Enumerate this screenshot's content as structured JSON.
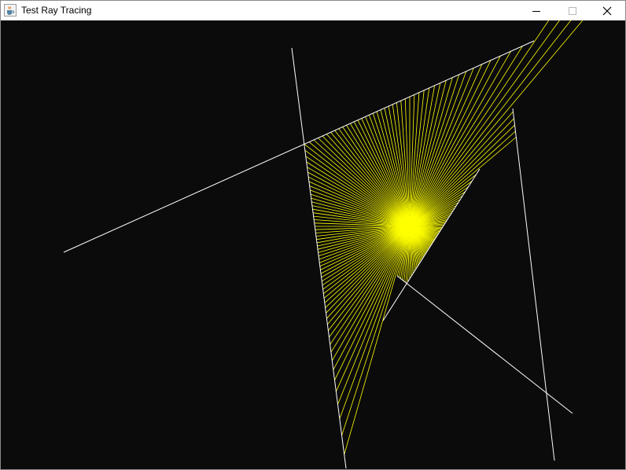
{
  "window": {
    "title": "Test Ray Tracing",
    "icons": {
      "app": "java-coffee-cup-icon",
      "minimize": "minimize-icon",
      "maximize": "maximize-icon",
      "close": "close-icon"
    }
  },
  "scene": {
    "background_color": "#0b0b0b",
    "wall_color": "#ffffff",
    "ray_color": "#ffff00",
    "light_source": "point-light"
  }
}
